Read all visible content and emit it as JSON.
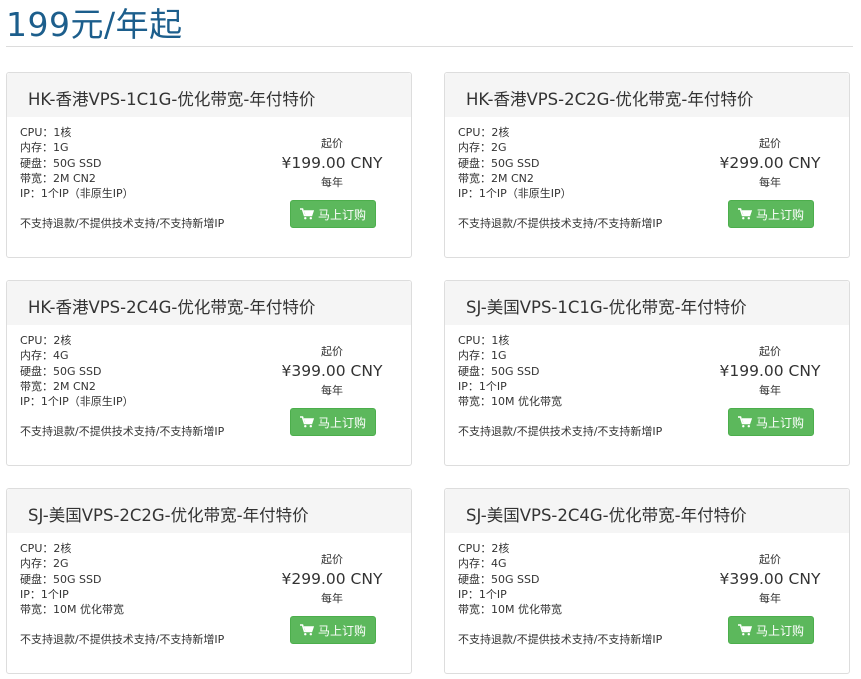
{
  "page": {
    "title": "199元/年起"
  },
  "cards": [
    {
      "title": "HK-香港VPS-1C1G-优化带宽-年付特价",
      "specs": [
        "CPU：1核",
        "内存：1G",
        "硬盘：50G SSD",
        "带宽：2M CN2",
        "IP：1个IP（非原生IP）"
      ],
      "notice": "不支持退款/不提供技术支持/不支持新增IP",
      "price_label": "起价",
      "price": "¥199.00 CNY",
      "period": "每年",
      "button_label": "马上订购",
      "button_icon": "cart-icon"
    },
    {
      "title": "HK-香港VPS-2C2G-优化带宽-年付特价",
      "specs": [
        "CPU：2核",
        "内存：2G",
        "硬盘：50G SSD",
        "带宽：2M CN2",
        "IP：1个IP（非原生IP）"
      ],
      "notice": "不支持退款/不提供技术支持/不支持新增IP",
      "price_label": "起价",
      "price": "¥299.00 CNY",
      "period": "每年",
      "button_label": "马上订购",
      "button_icon": "cart-icon"
    },
    {
      "title": "HK-香港VPS-2C4G-优化带宽-年付特价",
      "specs": [
        "CPU：2核",
        "内存：4G",
        "硬盘：50G SSD",
        "带宽：2M CN2",
        "IP：1个IP（非原生IP）"
      ],
      "notice": "不支持退款/不提供技术支持/不支持新增IP",
      "price_label": "起价",
      "price": "¥399.00 CNY",
      "period": "每年",
      "button_label": "马上订购",
      "button_icon": "cart-icon"
    },
    {
      "title": "SJ-美国VPS-1C1G-优化带宽-年付特价",
      "specs": [
        "CPU：1核",
        "内存：1G",
        "硬盘：50G SSD",
        "IP：1个IP",
        "带宽：10M 优化带宽"
      ],
      "notice": "不支持退款/不提供技术支持/不支持新增IP",
      "price_label": "起价",
      "price": "¥199.00 CNY",
      "period": "每年",
      "button_label": "马上订购",
      "button_icon": "cart-icon"
    },
    {
      "title": "SJ-美国VPS-2C2G-优化带宽-年付特价",
      "specs": [
        "CPU：2核",
        "内存：2G",
        "硬盘：50G SSD",
        "IP：1个IP",
        "带宽：10M 优化带宽"
      ],
      "notice": "不支持退款/不提供技术支持/不支持新增IP",
      "price_label": "起价",
      "price": "¥299.00 CNY",
      "period": "每年",
      "button_label": "马上订购",
      "button_icon": "cart-icon"
    },
    {
      "title": "SJ-美国VPS-2C4G-优化带宽-年付特价",
      "specs": [
        "CPU：2核",
        "内存：4G",
        "硬盘：50G SSD",
        "IP：1个IP",
        "带宽：10M 优化带宽"
      ],
      "notice": "不支持退款/不提供技术支持/不支持新增IP",
      "price_label": "起价",
      "price": "¥399.00 CNY",
      "period": "每年",
      "button_label": "马上订购",
      "button_icon": "cart-icon"
    }
  ],
  "colors": {
    "title": "#1c5e8c",
    "button": "#5cb85c",
    "card_header": "#f5f5f5"
  }
}
